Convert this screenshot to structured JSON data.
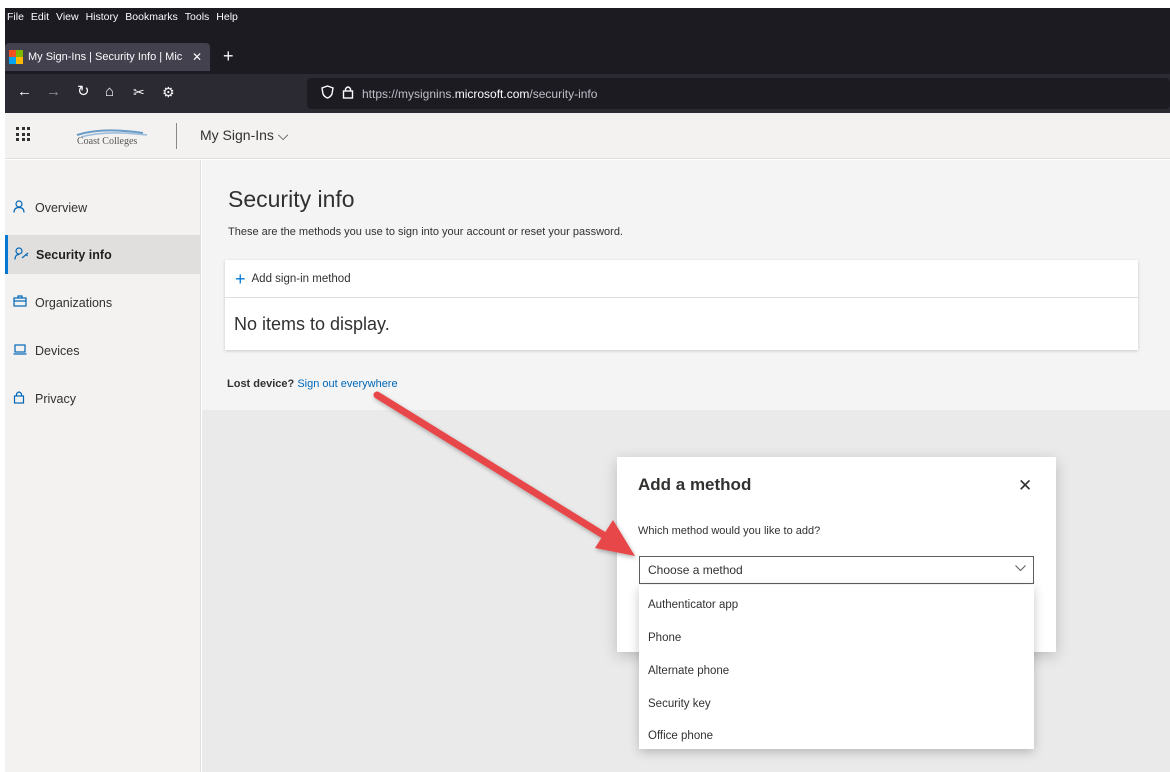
{
  "browser": {
    "menu": [
      "File",
      "Edit",
      "View",
      "History",
      "Bookmarks",
      "Tools",
      "Help"
    ],
    "tab_title": "My Sign-Ins | Security Info | Mic",
    "tab_close": "✕",
    "new_tab": "+",
    "url_prefix": "https://mysignins.",
    "url_domain": "microsoft.com",
    "url_path": "/security-info"
  },
  "header": {
    "brand": "Coast Colleges",
    "app_title": "My Sign-Ins ⌵"
  },
  "sidebar": {
    "items": [
      {
        "label": "Overview",
        "icon": "person-icon"
      },
      {
        "label": "Security info",
        "icon": "key-person-icon"
      },
      {
        "label": "Organizations",
        "icon": "briefcase-icon"
      },
      {
        "label": "Devices",
        "icon": "laptop-icon"
      },
      {
        "label": "Privacy",
        "icon": "lock-icon"
      }
    ]
  },
  "main": {
    "title": "Security info",
    "subtitle": "These are the methods you use to sign into your account or reset your password.",
    "add_method": "Add sign-in method",
    "empty": "No items to display.",
    "lost_label": "Lost device?",
    "lost_link": "Sign out everywhere"
  },
  "modal": {
    "title": "Add a method",
    "close": "✕",
    "question": "Which method would you like to add?",
    "select_value": "Choose a method",
    "options": [
      "Authenticator app",
      "Phone",
      "Alternate phone",
      "Security key",
      "Office phone"
    ]
  },
  "colors": {
    "accent": "#0078d4",
    "arrow": "#e8474a",
    "browser_dark": "#1c1b22"
  }
}
